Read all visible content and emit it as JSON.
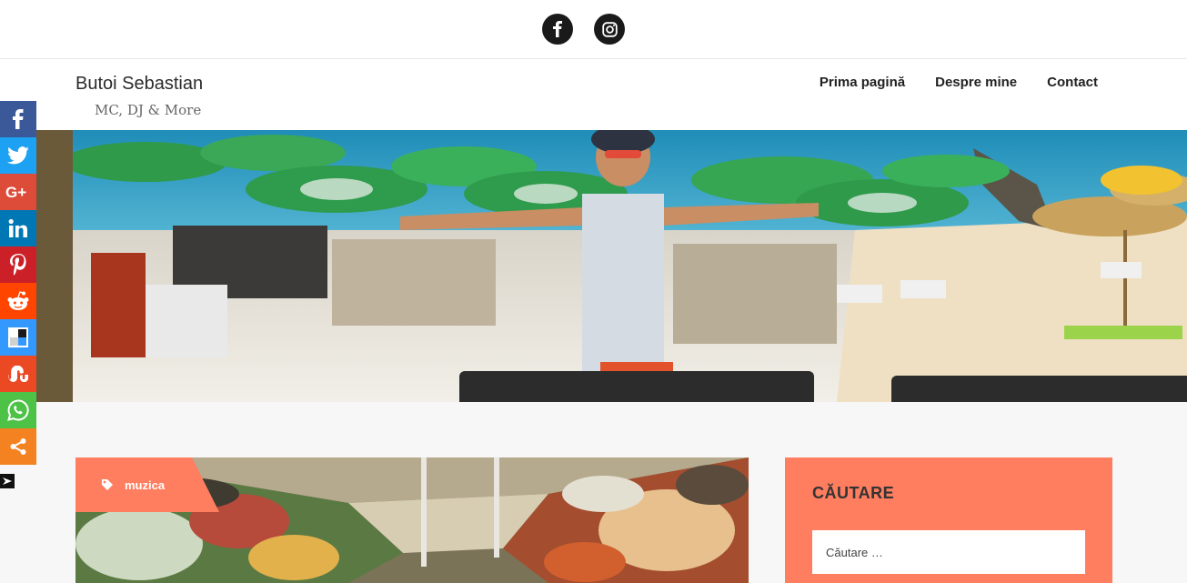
{
  "topbar": {
    "social": [
      {
        "name": "facebook",
        "icon": "facebook-icon"
      },
      {
        "name": "instagram",
        "icon": "instagram-icon"
      }
    ]
  },
  "header": {
    "title": "Butoi Sebastian",
    "tagline": "MC, DJ & More",
    "nav": [
      "Prima pagină",
      "Despre mine",
      "Contact"
    ]
  },
  "share_bar": {
    "buttons": [
      {
        "name": "facebook",
        "color": "#3b5998",
        "icon": "facebook-icon"
      },
      {
        "name": "twitter",
        "color": "#1da1f2",
        "icon": "twitter-icon"
      },
      {
        "name": "google-plus",
        "color": "#dd4b39",
        "icon": "google-plus-icon"
      },
      {
        "name": "linkedin",
        "color": "#0077b5",
        "icon": "linkedin-icon"
      },
      {
        "name": "pinterest",
        "color": "#cb2027",
        "icon": "pinterest-icon"
      },
      {
        "name": "reddit",
        "color": "#ff4500",
        "icon": "reddit-icon"
      },
      {
        "name": "delicious",
        "color": "#3399ff",
        "icon": "delicious-icon"
      },
      {
        "name": "stumbleupon",
        "color": "#eb4924",
        "icon": "stumbleupon-icon"
      },
      {
        "name": "whatsapp",
        "color": "#4dc247",
        "icon": "whatsapp-icon"
      },
      {
        "name": "more",
        "color": "#f58220",
        "icon": "share-icon"
      }
    ]
  },
  "post": {
    "tag": "muzica",
    "tag_color": "#ff7e60"
  },
  "widget": {
    "title": "CĂUTARE",
    "search_placeholder": "Căutare …",
    "background": "#ff7e60"
  }
}
